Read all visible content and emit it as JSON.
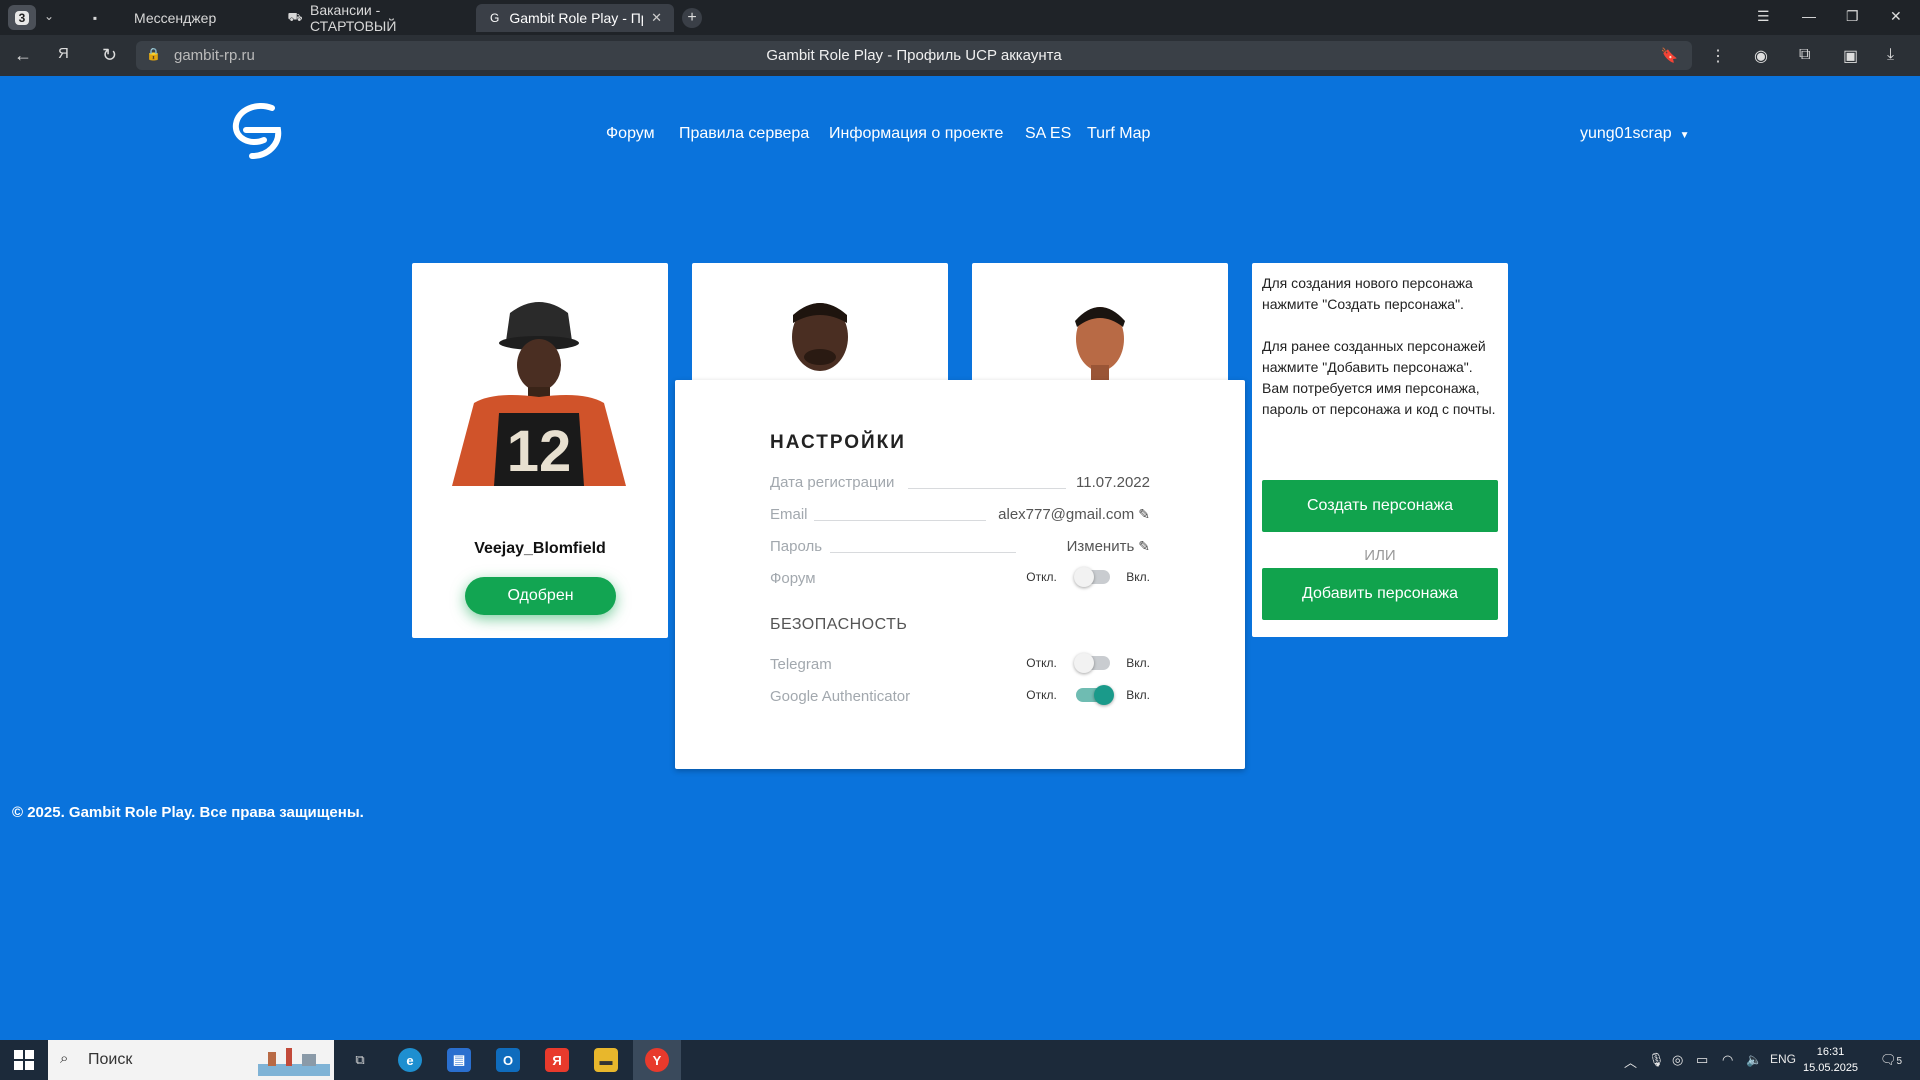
{
  "browser": {
    "tab_count": "3",
    "tabs": [
      {
        "label": "Мессенджер"
      },
      {
        "label": "Вакансии - СТАРТОВЫЙ"
      },
      {
        "label": "Gambit Role Play - Проф"
      }
    ],
    "url": "gambit-rp.ru",
    "page_title": "Gambit Role Play - Профиль UCP аккаунта"
  },
  "site": {
    "nav": [
      "Форум",
      "Правила сервера",
      "Информация о проекте",
      "SA ES",
      "Turf Map"
    ],
    "username": "yung01scrap"
  },
  "characters": [
    {
      "name": "Veejay_Blomfield",
      "status": "Одобрен"
    }
  ],
  "settings": {
    "title": "НАСТРОЙКИ",
    "reg_label": "Дата регистрации",
    "reg_value": "11.07.2022",
    "email_label": "Email",
    "email_value": "alex777@gmail.com",
    "password_label": "Пароль",
    "password_value": "Изменить",
    "forum_label": "Форум",
    "security_title": "БЕЗОПАСНОСТЬ",
    "telegram_label": "Telegram",
    "ga_label": "Google Authenticator",
    "off_label": "Откл.",
    "on_label": "Вкл.",
    "toggles": {
      "forum": false,
      "telegram": false,
      "google_authenticator": true
    }
  },
  "info": {
    "text1": "Для создания нового персонажа нажмите \"Создать персонажа\".",
    "text2": "Для ранее созданных персонажей нажмите \"Добавить персонажа\". Вам потребуется имя персонажа, пароль от персонажа и код с почты.",
    "create_button": "Создать персонажа",
    "or_label": "ИЛИ",
    "add_button": "Добавить персонажа"
  },
  "footer": "© 2025. Gambit Role Play. Все права защищены.",
  "taskbar": {
    "search_placeholder": "Поиск",
    "lang": "ENG",
    "time": "16:31",
    "date": "15.05.2025",
    "notification_count": "5"
  },
  "colors": {
    "page_bg": "#0a73dc",
    "green": "#11a34d",
    "toggle_on": "#1a9a8a"
  }
}
